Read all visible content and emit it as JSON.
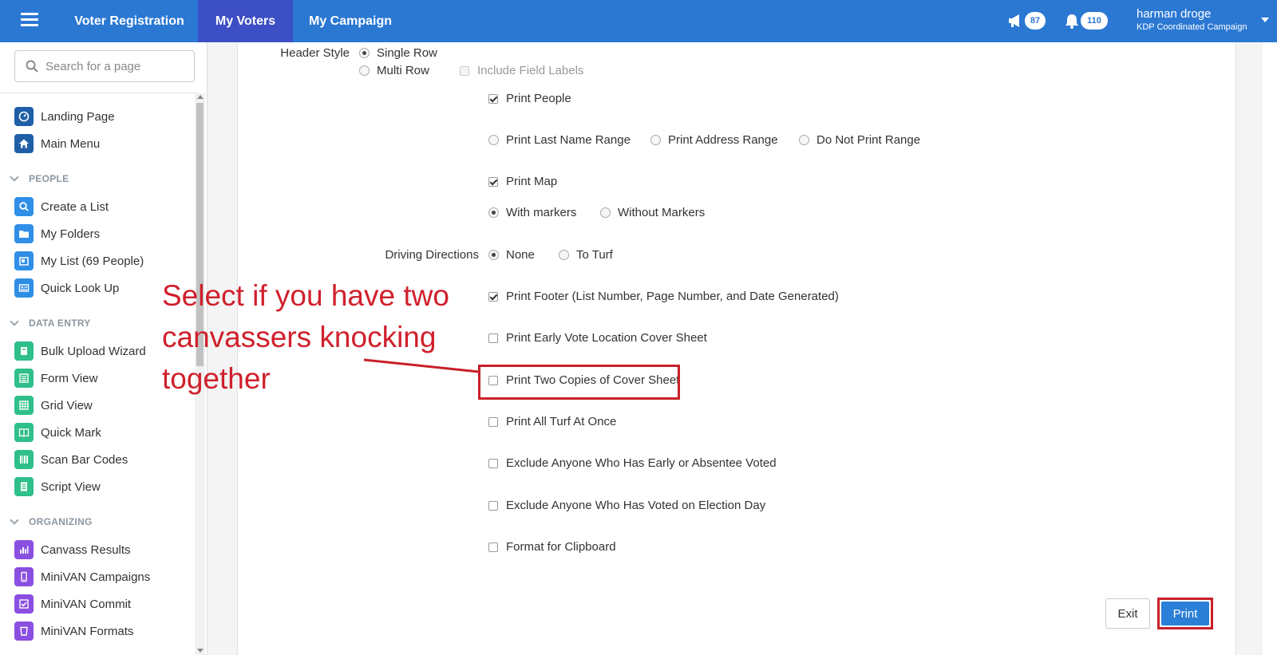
{
  "topbar": {
    "tabs": [
      "Voter Registration",
      "My Voters",
      "My Campaign"
    ],
    "active_tab": "My Voters",
    "notifications_count": "87",
    "alerts_count": "110",
    "user_name": "harman droge",
    "user_org": "KDP Coordinated Campaign",
    "accent_color": "#2b78d3",
    "active_tab_color": "#3d4fc4"
  },
  "sidebar": {
    "search_placeholder": "Search for a page",
    "top_items": [
      {
        "label": "Landing Page",
        "icon": "dashboard-icon"
      },
      {
        "label": "Main Menu",
        "icon": "home-icon"
      }
    ],
    "sections": [
      {
        "title": "PEOPLE",
        "items": [
          {
            "label": "Create a List",
            "icon": "search-icon"
          },
          {
            "label": "My Folders",
            "icon": "folder-icon"
          },
          {
            "label": "My List (69 People)",
            "icon": "list-icon"
          },
          {
            "label": "Quick Look Up",
            "icon": "id-card-icon"
          }
        ]
      },
      {
        "title": "DATA ENTRY",
        "items": [
          {
            "label": "Bulk Upload Wizard",
            "icon": "upload-icon"
          },
          {
            "label": "Form View",
            "icon": "form-icon"
          },
          {
            "label": "Grid View",
            "icon": "grid-icon"
          },
          {
            "label": "Quick Mark",
            "icon": "book-icon"
          },
          {
            "label": "Scan Bar Codes",
            "icon": "barcode-icon"
          },
          {
            "label": "Script View",
            "icon": "script-icon"
          }
        ]
      },
      {
        "title": "ORGANIZING",
        "items": [
          {
            "label": "Canvass Results",
            "icon": "bar-chart-icon"
          },
          {
            "label": "MiniVAN Campaigns",
            "icon": "phone-icon"
          },
          {
            "label": "MiniVAN Commit",
            "icon": "check-square-icon"
          },
          {
            "label": "MiniVAN Formats",
            "icon": "cup-icon"
          }
        ]
      }
    ]
  },
  "form": {
    "header_style_label": "Header Style",
    "single_row": "Single Row",
    "multi_row": "Multi Row",
    "include_field_labels": "Include Field Labels",
    "print_people": "Print People",
    "print_last_name_range": "Print Last Name Range",
    "print_address_range": "Print Address Range",
    "do_not_print_range": "Do Not Print Range",
    "print_map": "Print Map",
    "with_markers": "With markers",
    "without_markers": "Without Markers",
    "driving_directions_label": "Driving Directions",
    "none": "None",
    "to_turf": "To Turf",
    "print_footer": "Print Footer (List Number, Page Number, and Date Generated)",
    "print_early_vote": "Print Early Vote Location Cover Sheet",
    "print_two_copies": "Print Two Copies of Cover Sheet",
    "print_all_turf": "Print All Turf At Once",
    "exclude_early": "Exclude Anyone Who Has Early or Absentee Voted",
    "exclude_election_day": "Exclude Anyone Who Has Voted on Election Day",
    "format_clipboard": "Format for Clipboard"
  },
  "annotation": {
    "text": "Select if you have two canvassers knocking together",
    "color": "#d0202c"
  },
  "buttons": {
    "exit": "Exit",
    "print": "Print"
  }
}
